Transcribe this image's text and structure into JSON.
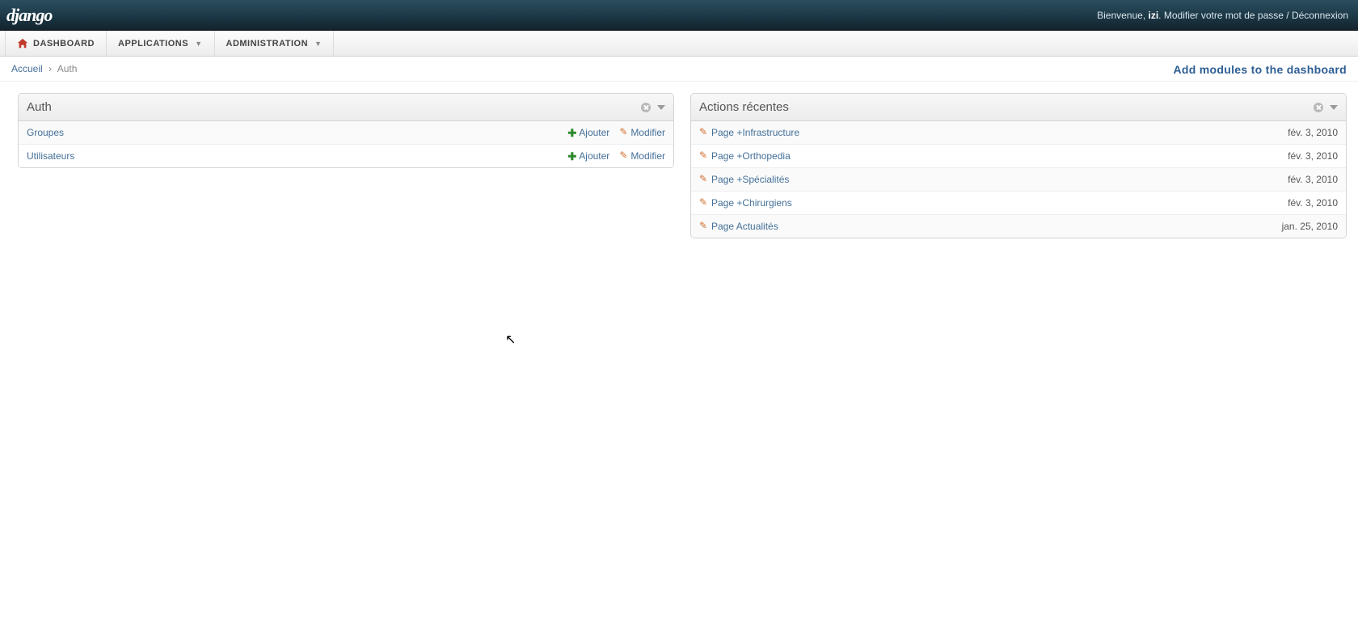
{
  "brand": "django",
  "user_greeting_prefix": "Bienvenue, ",
  "username": "izi",
  "user_greeting_suffix": ". ",
  "change_password": "Modifier votre mot de passe",
  "sep": " / ",
  "logout": "Déconnexion",
  "menu": {
    "dashboard": "DASHBOARD",
    "applications": "APPLICATIONS",
    "administration": "ADMINISTRATION"
  },
  "breadcrumb": {
    "home": "Accueil",
    "sep": "›",
    "current": "Auth"
  },
  "add_modules": "Add modules to the dashboard",
  "auth_module": {
    "title": "Auth",
    "add_label": "Ajouter",
    "change_label": "Modifier",
    "items": [
      {
        "label": "Groupes"
      },
      {
        "label": "Utilisateurs"
      }
    ]
  },
  "recent_module": {
    "title": "Actions récentes",
    "items": [
      {
        "label": "Page +Infrastructure",
        "date": "fév. 3, 2010"
      },
      {
        "label": "Page +Orthopedia",
        "date": "fév. 3, 2010"
      },
      {
        "label": "Page +Spécialités",
        "date": "fév. 3, 2010"
      },
      {
        "label": "Page +Chirurgiens",
        "date": "fév. 3, 2010"
      },
      {
        "label": "Page Actualités",
        "date": "jan. 25, 2010"
      }
    ]
  }
}
